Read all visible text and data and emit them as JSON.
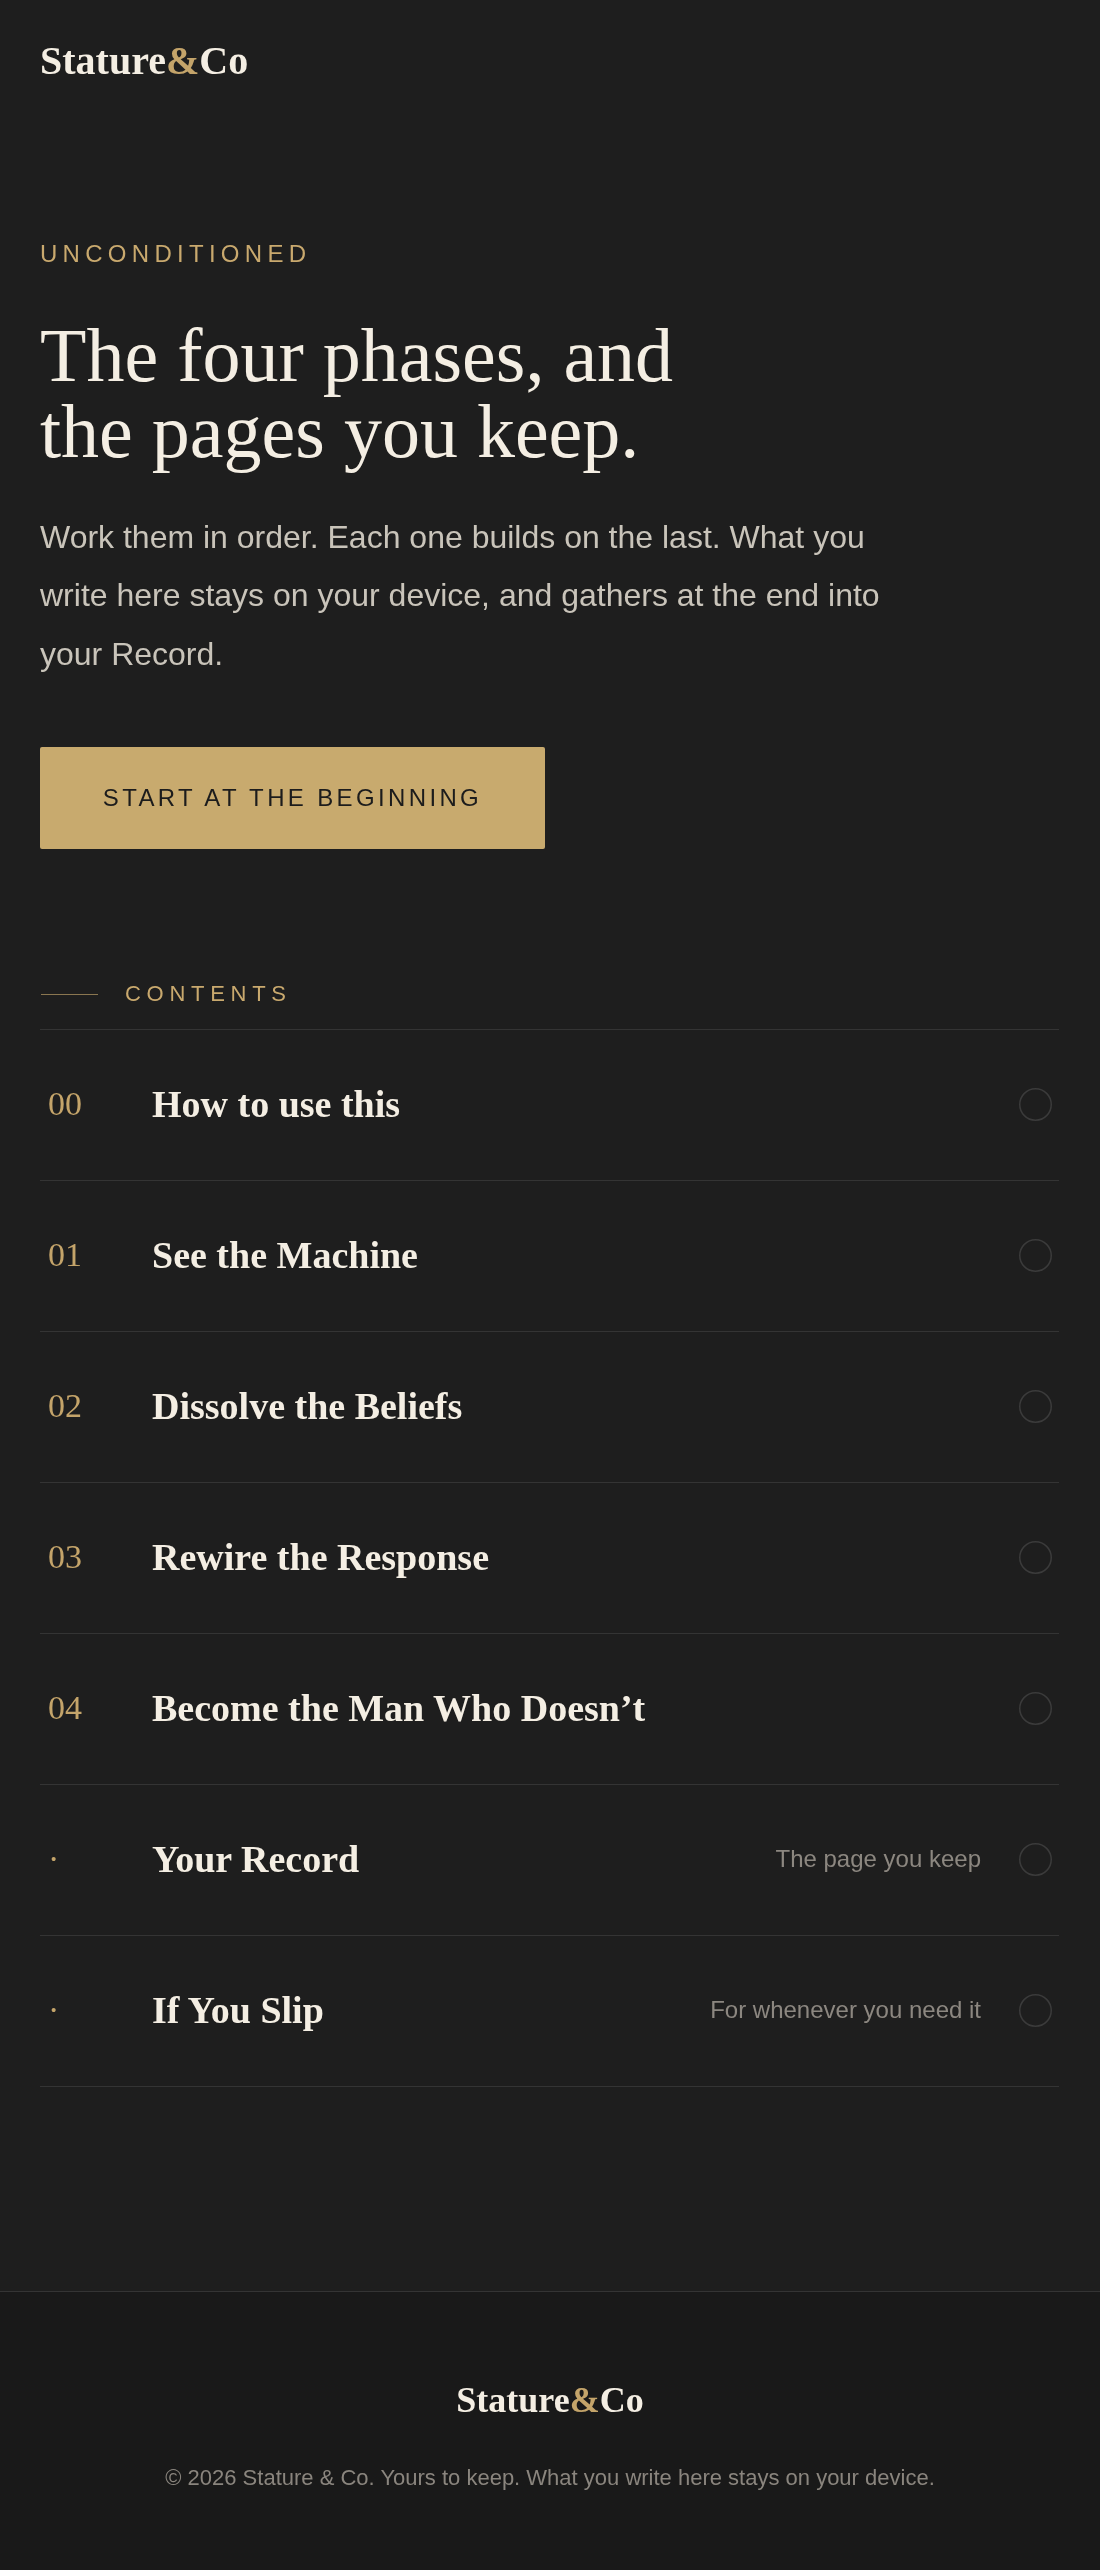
{
  "header": {
    "logo": {
      "word": "Stature",
      "ampersand": "&",
      "suffix": "Co"
    }
  },
  "hero": {
    "eyebrow": "UNCONDITIONED",
    "title": "The four phases, and the pages you keep.",
    "intro": "Work them in order. Each one builds on the last. What you write here stays on your device, and gathers at the end into your Record.",
    "button": "START AT THE BEGINNING"
  },
  "contents": {
    "label": "CONTENTS",
    "items": [
      {
        "number": "00",
        "title": "How to use this",
        "completed": false
      },
      {
        "number": "01",
        "title": "See the Machine",
        "completed": false
      },
      {
        "number": "02",
        "title": "Dissolve the Beliefs",
        "completed": false
      },
      {
        "number": "03",
        "title": "Rewire the Response",
        "completed": false
      },
      {
        "number": "04",
        "title": "Become the Man Who Doesn’t",
        "completed": false
      },
      {
        "number": "·",
        "title": "Your Record",
        "subtitle": "The page you keep",
        "completed": false
      },
      {
        "number": "·",
        "title": "If You Slip",
        "subtitle": "For whenever you need it",
        "completed": false
      }
    ]
  },
  "footer": {
    "logo": {
      "word": "Stature",
      "ampersand": "&",
      "suffix": "Co"
    },
    "copyright": "© 2026 Stature & Co. Yours to keep. What you write here stays on your device."
  }
}
